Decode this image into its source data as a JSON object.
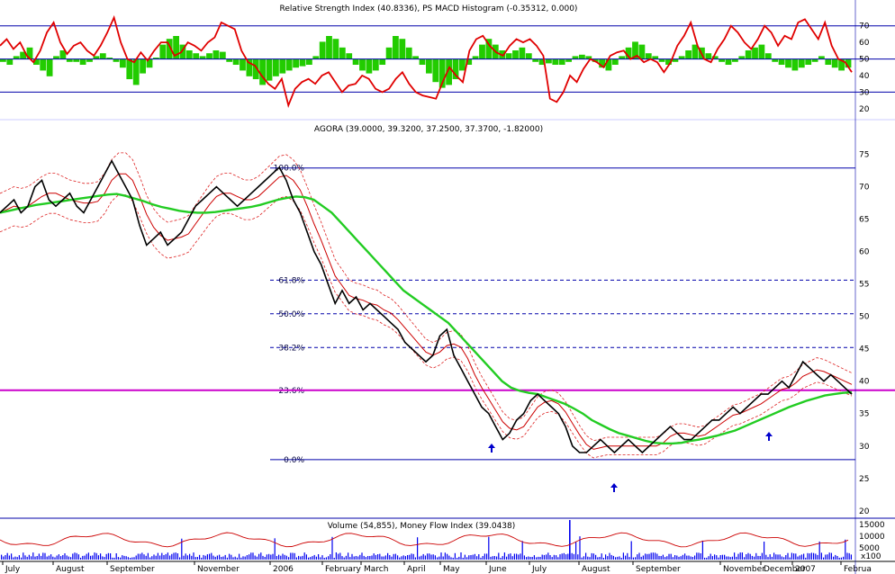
{
  "chart_data": [
    {
      "type": "line",
      "panel": "rsi",
      "title": "Relative Strength Index (40.8336), PS MACD Histogram (-0.35312, 0.000)",
      "ylim": [
        15,
        78
      ],
      "y_ticks": [
        20,
        30,
        40,
        50,
        60,
        70
      ],
      "reference_lines": [
        70,
        50,
        30
      ],
      "colors": {
        "rsi": "#e00000",
        "histogram": "#22cc00",
        "ref": "#0000aa"
      },
      "series": [
        {
          "values": [
            58,
            62,
            56,
            60,
            52,
            48,
            55,
            66,
            72,
            60,
            53,
            58,
            60,
            55,
            52,
            58,
            66,
            75,
            60,
            50,
            48,
            54,
            49,
            55,
            60,
            60,
            52,
            54,
            60,
            58,
            55,
            60,
            63,
            72,
            70,
            68,
            55,
            48,
            46,
            40,
            35,
            32,
            38,
            22,
            32,
            36,
            38,
            35,
            40,
            42,
            36,
            30,
            34,
            35,
            40,
            38,
            32,
            30,
            32,
            38,
            42,
            35,
            30,
            28,
            27,
            26,
            36,
            45,
            40,
            36,
            55,
            62,
            64,
            58,
            54,
            52,
            58,
            62,
            60,
            62,
            58,
            52,
            26,
            24,
            30,
            40,
            36,
            44,
            50,
            48,
            45,
            52,
            54,
            55,
            50,
            52,
            48,
            50,
            48,
            42,
            48,
            58,
            64,
            72,
            58,
            50,
            48,
            56,
            62,
            70,
            66,
            60,
            56,
            62,
            70,
            66,
            58,
            64,
            62,
            72,
            74,
            68,
            62,
            72,
            58,
            50,
            48,
            42
          ]
        },
        {
          "values": [
            -2,
            -4,
            2,
            5,
            8,
            -4,
            -8,
            -12,
            2,
            6,
            -2,
            -2,
            -4,
            -2,
            2,
            4,
            1,
            -2,
            -6,
            -14,
            -18,
            -10,
            -6,
            1,
            10,
            14,
            16,
            10,
            6,
            4,
            2,
            4,
            6,
            5,
            -2,
            -4,
            -8,
            -12,
            -14,
            -18,
            -15,
            -12,
            -10,
            -8,
            -6,
            -5,
            -4,
            2,
            12,
            16,
            14,
            8,
            4,
            -4,
            -8,
            -10,
            -8,
            -4,
            8,
            16,
            14,
            8,
            2,
            -4,
            -10,
            -16,
            -20,
            -18,
            -14,
            -8,
            -4,
            2,
            10,
            14,
            10,
            6,
            4,
            6,
            8,
            4,
            -2,
            -4,
            -3,
            -4,
            -4,
            -2,
            2,
            3,
            2,
            -2,
            -6,
            -8,
            -4,
            2,
            8,
            12,
            10,
            4,
            2,
            -2,
            -4,
            -2,
            2,
            6,
            10,
            8,
            4,
            2,
            -2,
            -4,
            -2,
            2,
            6,
            8,
            10,
            4,
            -2,
            -4,
            -6,
            -8,
            -6,
            -4,
            -2,
            2,
            -4,
            -6,
            -8,
            -6
          ]
        }
      ]
    },
    {
      "type": "line",
      "panel": "price",
      "title": "AGORA (39.0000, 39.3200, 37.2500, 37.3700, -1.82000)",
      "ylim": [
        19,
        78
      ],
      "y_ticks": [
        20,
        25,
        30,
        35,
        40,
        45,
        50,
        55,
        60,
        65,
        70,
        75
      ],
      "fibonacci": [
        {
          "label": "100.0%",
          "value": 72.9
        },
        {
          "label": "61.8%",
          "value": 55.6
        },
        {
          "label": "50.0%",
          "value": 50.4
        },
        {
          "label": "38.2%",
          "value": 45.2
        },
        {
          "label": "23.6%",
          "value": 38.6
        },
        {
          "label": "0.0%",
          "value": 27.9
        }
      ],
      "colors": {
        "price": "#000000",
        "ma_long": "#22cc22",
        "ma_short": "#cc0000",
        "band": "#dd2222",
        "fib": "#0000aa",
        "support": "#cc00cc",
        "arrow": "#0000cc"
      },
      "support_level": 38.6,
      "arrows_x": [
        546,
        682,
        854
      ],
      "series": [
        {
          "values": [
            66,
            67,
            68,
            66,
            67,
            70,
            71,
            68,
            67,
            68,
            69,
            67,
            66,
            68,
            70,
            72,
            74,
            72,
            70,
            68,
            64,
            61,
            62,
            63,
            61,
            62,
            63,
            65,
            67,
            68,
            69,
            70,
            69,
            68,
            67,
            68,
            69,
            70,
            71,
            72,
            73,
            71,
            68,
            66,
            63,
            60,
            58,
            55,
            52,
            54,
            52,
            53,
            51,
            52,
            51,
            50,
            49,
            48,
            46,
            45,
            44,
            43,
            44,
            47,
            48,
            44,
            42,
            40,
            38,
            36,
            35,
            33,
            31,
            32,
            34,
            35,
            37,
            38,
            37,
            36,
            35,
            33,
            30,
            29,
            29,
            30,
            31,
            30,
            29,
            30,
            31,
            30,
            29,
            30,
            31,
            32,
            33,
            32,
            31,
            31,
            32,
            33,
            34,
            34,
            35,
            36,
            35,
            36,
            37,
            38,
            38,
            39,
            40,
            39,
            41,
            43,
            42,
            41,
            40,
            41,
            40,
            39,
            38
          ]
        },
        {
          "values": [
            66,
            66.3,
            66.6,
            66.9,
            67.2,
            67.4,
            67.6,
            67.8,
            68,
            68.2,
            68.4,
            68.6,
            68.8,
            68.9,
            68.6,
            68.2,
            67.8,
            67.3,
            66.9,
            66.6,
            66.3,
            66.1,
            66,
            66,
            66.1,
            66.3,
            66.5,
            66.7,
            66.9,
            67.2,
            67.6,
            68,
            68.3,
            68.5,
            68.4,
            68,
            67,
            66,
            64.5,
            63,
            61.5,
            60,
            58.5,
            57,
            55.5,
            54,
            53,
            52,
            51,
            50,
            49,
            47.5,
            46,
            44.5,
            43,
            41.5,
            40,
            39,
            38.5,
            38.2,
            38,
            37.5,
            37,
            36.5,
            35.8,
            35,
            34,
            33.3,
            32.6,
            32,
            31.6,
            31.2,
            30.8,
            30.5,
            30.4,
            30.4,
            30.5,
            30.8,
            31,
            31.3,
            31.6,
            32,
            32.4,
            33,
            33.6,
            34.2,
            34.8,
            35.4,
            36,
            36.5,
            37,
            37.4,
            37.8,
            38,
            38.2,
            38.3
          ]
        }
      ]
    },
    {
      "type": "bar",
      "panel": "volume",
      "title": "Volume (54,855), Money Flow Index (39.0438)",
      "y_ticks": [
        15000,
        10000,
        5000
      ],
      "tick_labels": [
        "15000",
        "10000",
        "5000"
      ],
      "scale_note": "x100",
      "colors": {
        "volume": "#0000ee",
        "mfi": "#cc0000"
      },
      "series": []
    }
  ],
  "x_axis": {
    "month_labels": [
      {
        "label": "July",
        "x": 6
      },
      {
        "label": "August",
        "x": 62
      },
      {
        "label": "September",
        "x": 122
      },
      {
        "label": "November",
        "x": 219
      },
      {
        "label": "2006",
        "x": 303
      },
      {
        "label": "February",
        "x": 361
      },
      {
        "label": "March",
        "x": 404
      },
      {
        "label": "April",
        "x": 452
      },
      {
        "label": "May",
        "x": 492
      },
      {
        "label": "June",
        "x": 543
      },
      {
        "label": "July",
        "x": 591
      },
      {
        "label": "August",
        "x": 646
      },
      {
        "label": "September",
        "x": 706
      },
      {
        "label": "November",
        "x": 803
      },
      {
        "label": "December",
        "x": 848
      },
      {
        "label": "2007",
        "x": 883
      },
      {
        "label": "Februa",
        "x": 937
      }
    ]
  }
}
